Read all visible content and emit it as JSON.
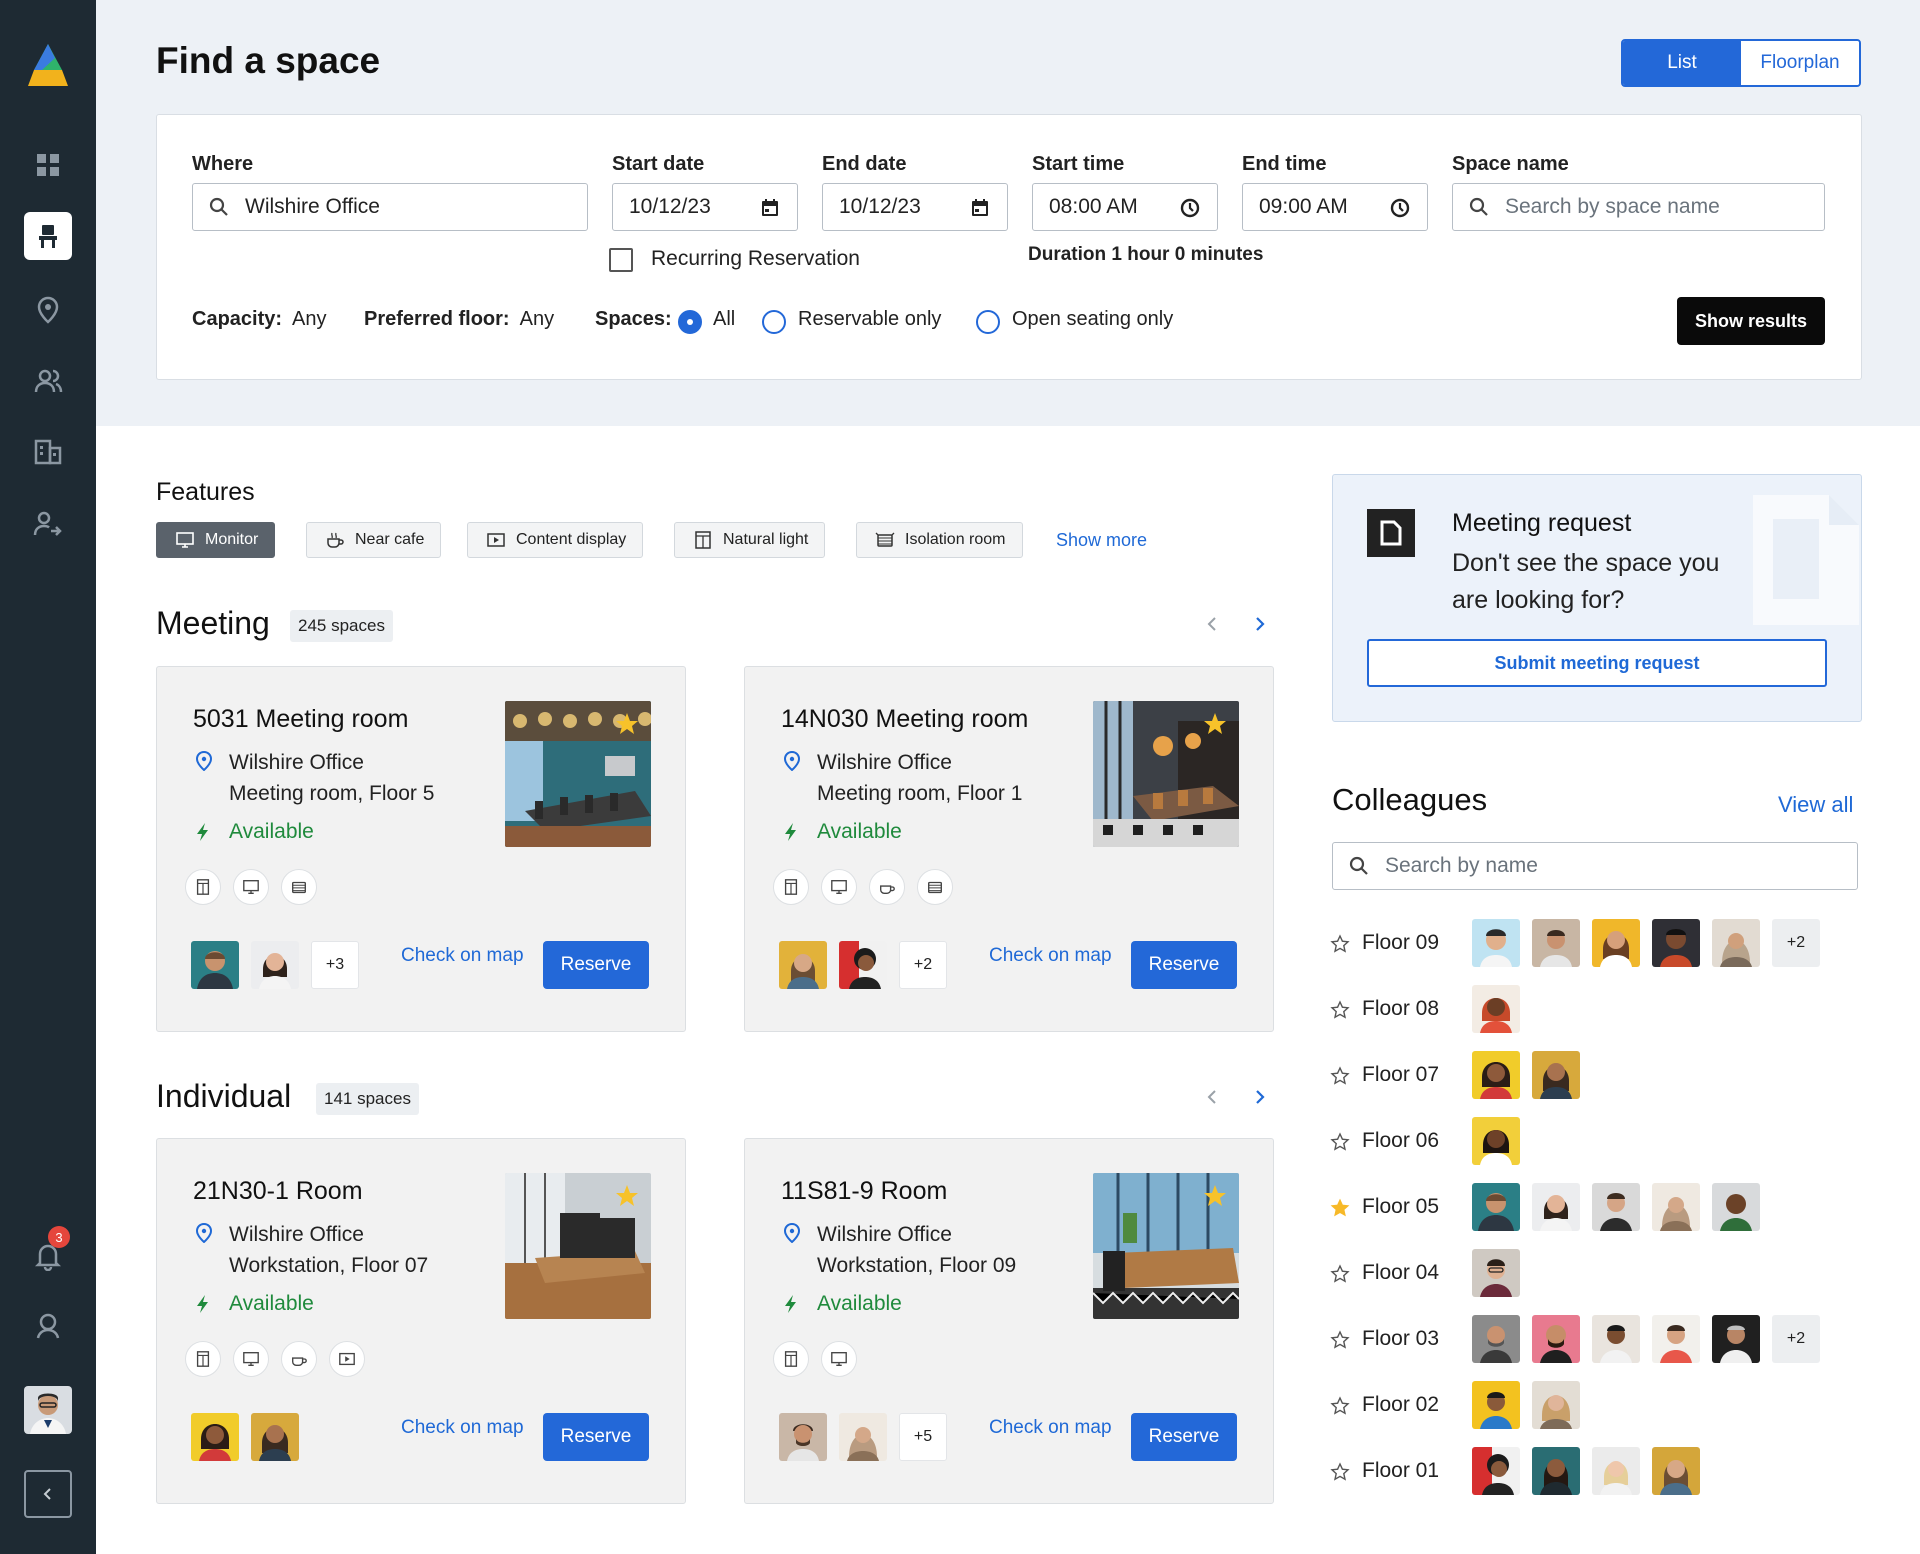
{
  "page": {
    "title": "Find a space"
  },
  "view_toggle": {
    "list": "List",
    "floorplan": "Floorplan"
  },
  "sidebar": {
    "notification_count": "3"
  },
  "filters": {
    "where_label": "Where",
    "where_value": "Wilshire Office",
    "start_date_label": "Start date",
    "start_date": "10/12/23",
    "end_date_label": "End date",
    "end_date": "10/12/23",
    "start_time_label": "Start time",
    "start_time": "08:00 AM",
    "end_time_label": "End time",
    "end_time": "09:00 AM",
    "space_name_label": "Space name",
    "space_name_placeholder": "Search by space name",
    "recurring_label": "Recurring Reservation",
    "duration": "Duration 1 hour 0 minutes",
    "capacity_label": "Capacity:",
    "capacity_value": "Any",
    "floor_label": "Preferred floor:",
    "floor_value": "Any",
    "spaces_label": "Spaces:",
    "spaces_options": [
      "All",
      "Reservable only",
      "Open seating only"
    ],
    "spaces_selected": "All",
    "show_results": "Show results"
  },
  "features": {
    "heading": "Features",
    "chips": [
      {
        "label": "Monitor",
        "icon": "monitor-icon",
        "selected": true
      },
      {
        "label": "Near cafe",
        "icon": "coffee-icon",
        "selected": false
      },
      {
        "label": "Content display",
        "icon": "display-icon",
        "selected": false
      },
      {
        "label": "Natural light",
        "icon": "window-icon",
        "selected": false
      },
      {
        "label": "Isolation room",
        "icon": "isolation-icon",
        "selected": false
      }
    ],
    "show_more": "Show more"
  },
  "meeting": {
    "title": "Meeting",
    "count": "245 spaces",
    "cards": [
      {
        "name": "5031 Meeting room",
        "office": "Wilshire Office",
        "detail": "Meeting room, Floor 5",
        "status": "Available",
        "extra": "+3",
        "check": "Check on map",
        "reserve": "Reserve"
      },
      {
        "name": "14N030 Meeting room",
        "office": "Wilshire Office",
        "detail": "Meeting room, Floor 1",
        "status": "Available",
        "extra": "+2",
        "check": "Check on map",
        "reserve": "Reserve"
      }
    ]
  },
  "individual": {
    "title": "Individual",
    "count": "141 spaces",
    "cards": [
      {
        "name": "21N30-1 Room",
        "office": "Wilshire Office",
        "detail": "Workstation, Floor 07",
        "status": "Available",
        "check": "Check on map",
        "reserve": "Reserve"
      },
      {
        "name": "11S81-9 Room",
        "office": "Wilshire Office",
        "detail": "Workstation, Floor 09",
        "status": "Available",
        "extra": "+5",
        "check": "Check on map",
        "reserve": "Reserve"
      }
    ]
  },
  "meeting_request": {
    "title": "Meeting request",
    "body": "Don't see the space you are looking for?",
    "button": "Submit meeting request"
  },
  "colleagues": {
    "heading": "Colleagues",
    "view_all": "View all",
    "search_placeholder": "Search by name",
    "floors": [
      {
        "name": "Floor 09",
        "starred": false,
        "extra": "+2"
      },
      {
        "name": "Floor 08",
        "starred": false
      },
      {
        "name": "Floor 07",
        "starred": false
      },
      {
        "name": "Floor 06",
        "starred": false
      },
      {
        "name": "Floor 05",
        "starred": true
      },
      {
        "name": "Floor 04",
        "starred": false
      },
      {
        "name": "Floor 03",
        "starred": false,
        "extra": "+2"
      },
      {
        "name": "Floor 02",
        "starred": false
      },
      {
        "name": "Floor 01",
        "starred": false
      }
    ]
  },
  "colors": {
    "accent": "#2368d8",
    "available": "#1f8a3c",
    "sidebar": "#1e2a33"
  }
}
